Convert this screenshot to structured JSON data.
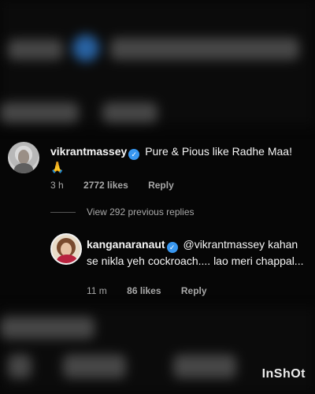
{
  "comment1": {
    "username": "vikrantmassey",
    "verified": true,
    "text": "Pure & Pious like Radhe Maa!",
    "emoji": "🙏",
    "time": "3 h",
    "likes": "2772 likes",
    "reply_label": "Reply"
  },
  "view_replies": "View 292 previous replies",
  "comment2": {
    "username": "kanganaranaut",
    "verified": true,
    "mention": "@vikrantmassey",
    "text": "kahan se nikla yeh cockroach.... lao meri chappal...",
    "time": "11 m",
    "likes": "86 likes",
    "reply_label": "Reply"
  },
  "watermark": "InShOt",
  "colors": {
    "background": "#060606",
    "text": "#f5f5f5",
    "meta": "#a8a8a8",
    "verified": "#3897f0"
  }
}
